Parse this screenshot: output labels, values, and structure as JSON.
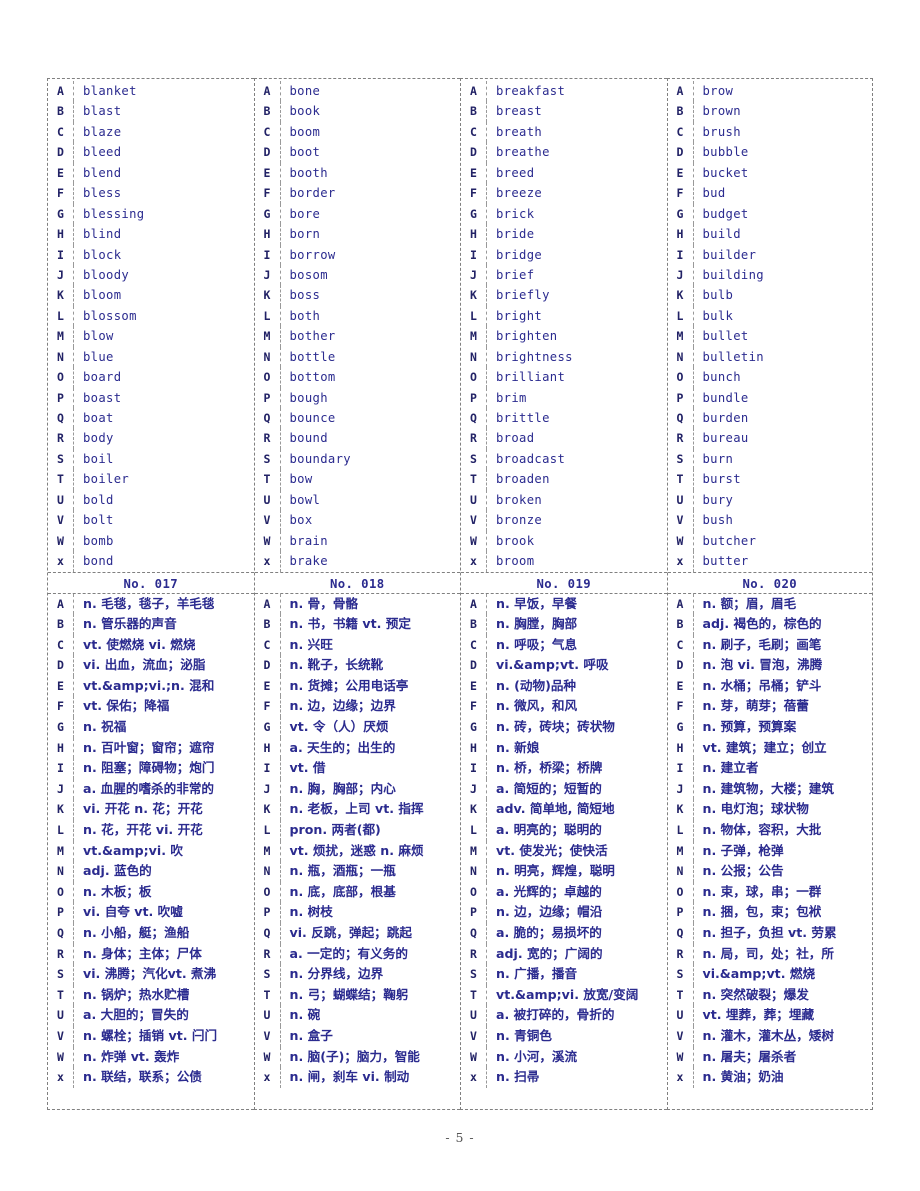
{
  "page": {
    "footer": "- 5 -"
  },
  "columns": [
    {
      "id": "col-1",
      "group_label": "No. 017",
      "keys": [
        "A",
        "B",
        "C",
        "D",
        "E",
        "F",
        "G",
        "H",
        "I",
        "J",
        "K",
        "L",
        "M",
        "N",
        "O",
        "P",
        "Q",
        "R",
        "S",
        "T",
        "U",
        "V",
        "W",
        "x"
      ],
      "words": [
        "blanket",
        "blast",
        "blaze",
        "bleed",
        "blend",
        "bless",
        "blessing",
        "blind",
        "block",
        "bloody",
        "bloom",
        "blossom",
        "blow",
        "blue",
        "board",
        "boast",
        "boat",
        "body",
        "boil",
        "boiler",
        "bold",
        "bolt",
        "bomb",
        "bond"
      ],
      "definitions": [
        "n. 毛毯，毯子，羊毛毯",
        "n. 管乐器的声音",
        "vt. 使燃烧 vi. 燃烧",
        "vi. 出血，流血；泌脂",
        "vt.&amp;vi.;n. 混和",
        "vt. 保佑；降福",
        "n. 祝福",
        "n. 百叶窗；窗帘；遮帘",
        "n. 阻塞；障碍物；炮门",
        "a. 血腥的嗜杀的非常的",
        "vi. 开花 n. 花；开花",
        "n. 花，开花 vi. 开花",
        "vt.&amp;vi. 吹",
        "adj. 蓝色的",
        "n. 木板；板",
        "vi. 自夸 vt. 吹嘘",
        "n. 小船，艇；渔船",
        "n. 身体；主体；尸体",
        "vi. 沸腾；汽化vt. 煮沸",
        "n. 锅炉；热水贮槽",
        "a. 大胆的；冒失的",
        "n. 螺栓；插销 vt. 闩门",
        "n. 炸弹 vt. 轰炸",
        "n. 联结，联系；公债"
      ]
    },
    {
      "id": "col-2",
      "group_label": "No. 018",
      "keys": [
        "A",
        "B",
        "C",
        "D",
        "E",
        "F",
        "G",
        "H",
        "I",
        "J",
        "K",
        "L",
        "M",
        "N",
        "O",
        "P",
        "Q",
        "R",
        "S",
        "T",
        "U",
        "V",
        "W",
        "x"
      ],
      "words": [
        "bone",
        "book",
        "boom",
        "boot",
        "booth",
        "border",
        "bore",
        "born",
        "borrow",
        "bosom",
        "boss",
        "both",
        "bother",
        "bottle",
        "bottom",
        "bough",
        "bounce",
        "bound",
        "boundary",
        "bow",
        "bowl",
        "box",
        "brain",
        "brake"
      ],
      "definitions": [
        "n. 骨，骨骼",
        "n. 书，书籍 vt. 预定",
        "n. 兴旺",
        "n. 靴子，长统靴",
        "n. 货摊；公用电话亭",
        "n. 边，边缘；边界",
        "vt. 令（人）厌烦",
        "a. 天生的；出生的",
        "vt. 借",
        "n. 胸，胸部；内心",
        "n. 老板，上司 vt. 指挥",
        "pron. 两者(都)",
        "vt. 烦扰，迷惑 n. 麻烦",
        "n. 瓶，酒瓶；一瓶",
        "n. 底，底部，根基",
        "n. 树枝",
        "vi. 反跳，弹起；跳起",
        "a. 一定的；有义务的",
        "n. 分界线，边界",
        "n. 弓；蝴蝶结；鞠躬",
        "n. 碗",
        "n. 盒子",
        "n. 脑(子)；脑力，智能",
        "n. 闸，刹车 vi. 制动"
      ]
    },
    {
      "id": "col-3",
      "group_label": "No. 019",
      "keys": [
        "A",
        "B",
        "C",
        "D",
        "E",
        "F",
        "G",
        "H",
        "I",
        "J",
        "K",
        "L",
        "M",
        "N",
        "O",
        "P",
        "Q",
        "R",
        "S",
        "T",
        "U",
        "V",
        "W",
        "x"
      ],
      "words": [
        "breakfast",
        "breast",
        "breath",
        "breathe",
        "breed",
        "breeze",
        "brick",
        "bride",
        "bridge",
        "brief",
        "briefly",
        "bright",
        "brighten",
        "brightness",
        "brilliant",
        "brim",
        "brittle",
        "broad",
        "broadcast",
        "broaden",
        "broken",
        "bronze",
        "brook",
        "broom"
      ],
      "definitions": [
        "n. 早饭，早餐",
        "n. 胸膛，胸部",
        "n. 呼吸；气息",
        "vi.&amp;vt. 呼吸",
        "n. (动物)品种",
        "n. 微风，和风",
        "n. 砖，砖块；砖状物",
        "n. 新娘",
        "n. 桥，桥梁；桥牌",
        "a. 简短的；短暂的",
        "adv. 简单地, 简短地",
        "a. 明亮的；聪明的",
        "vt. 使发光；使快活",
        "n. 明亮，辉煌，聪明",
        "a. 光辉的；卓越的",
        "n. 边，边缘；帽沿",
        "a. 脆的；易损坏的",
        "adj. 宽的；广阔的",
        "n. 广播，播音",
        "vt.&amp;vi. 放宽/变阔",
        "a. 被打碎的，骨折的",
        "n. 青铜色",
        "n. 小河，溪流",
        "n. 扫帚"
      ]
    },
    {
      "id": "col-4",
      "group_label": "No. 020",
      "keys": [
        "A",
        "B",
        "C",
        "D",
        "E",
        "F",
        "G",
        "H",
        "I",
        "J",
        "K",
        "L",
        "M",
        "N",
        "O",
        "P",
        "Q",
        "R",
        "S",
        "T",
        "U",
        "V",
        "W",
        "x"
      ],
      "words": [
        "brow",
        "brown",
        "brush",
        "bubble",
        "bucket",
        "bud",
        "budget",
        "build",
        "builder",
        "building",
        "bulb",
        "bulk",
        "bullet",
        "bulletin",
        "bunch",
        "bundle",
        "burden",
        "bureau",
        "burn",
        "burst",
        "bury",
        "bush",
        "butcher",
        "butter"
      ],
      "definitions": [
        "n. 额；眉，眉毛",
        "adj. 褐色的，棕色的",
        "n. 刷子，毛刷；画笔",
        "n. 泡 vi. 冒泡，沸腾",
        "n. 水桶；吊桶；铲斗",
        "n. 芽，萌芽；蓓蕾",
        "n. 预算，预算案",
        "vt. 建筑；建立；创立",
        "n. 建立者",
        "n. 建筑物，大楼；建筑",
        "n. 电灯泡；球状物",
        "n. 物体，容积，大批",
        "n. 子弹，枪弹",
        "n. 公报；公告",
        "n. 束，球，串；一群",
        "n. 捆，包，束；包袱",
        "n. 担子，负担 vt. 劳累",
        "n. 局，司，处；社，所",
        "vi.&amp;vt. 燃烧",
        "n. 突然破裂；爆发",
        "vt. 埋葬，葬；埋藏",
        "n. 灌木，灌木丛，矮树",
        "n. 屠夫；屠杀者",
        "n. 黄油；奶油"
      ]
    }
  ],
  "colors": {
    "text_blue": "#2b2b8f",
    "border_gray": "#808080",
    "footer_gray": "#555555"
  }
}
